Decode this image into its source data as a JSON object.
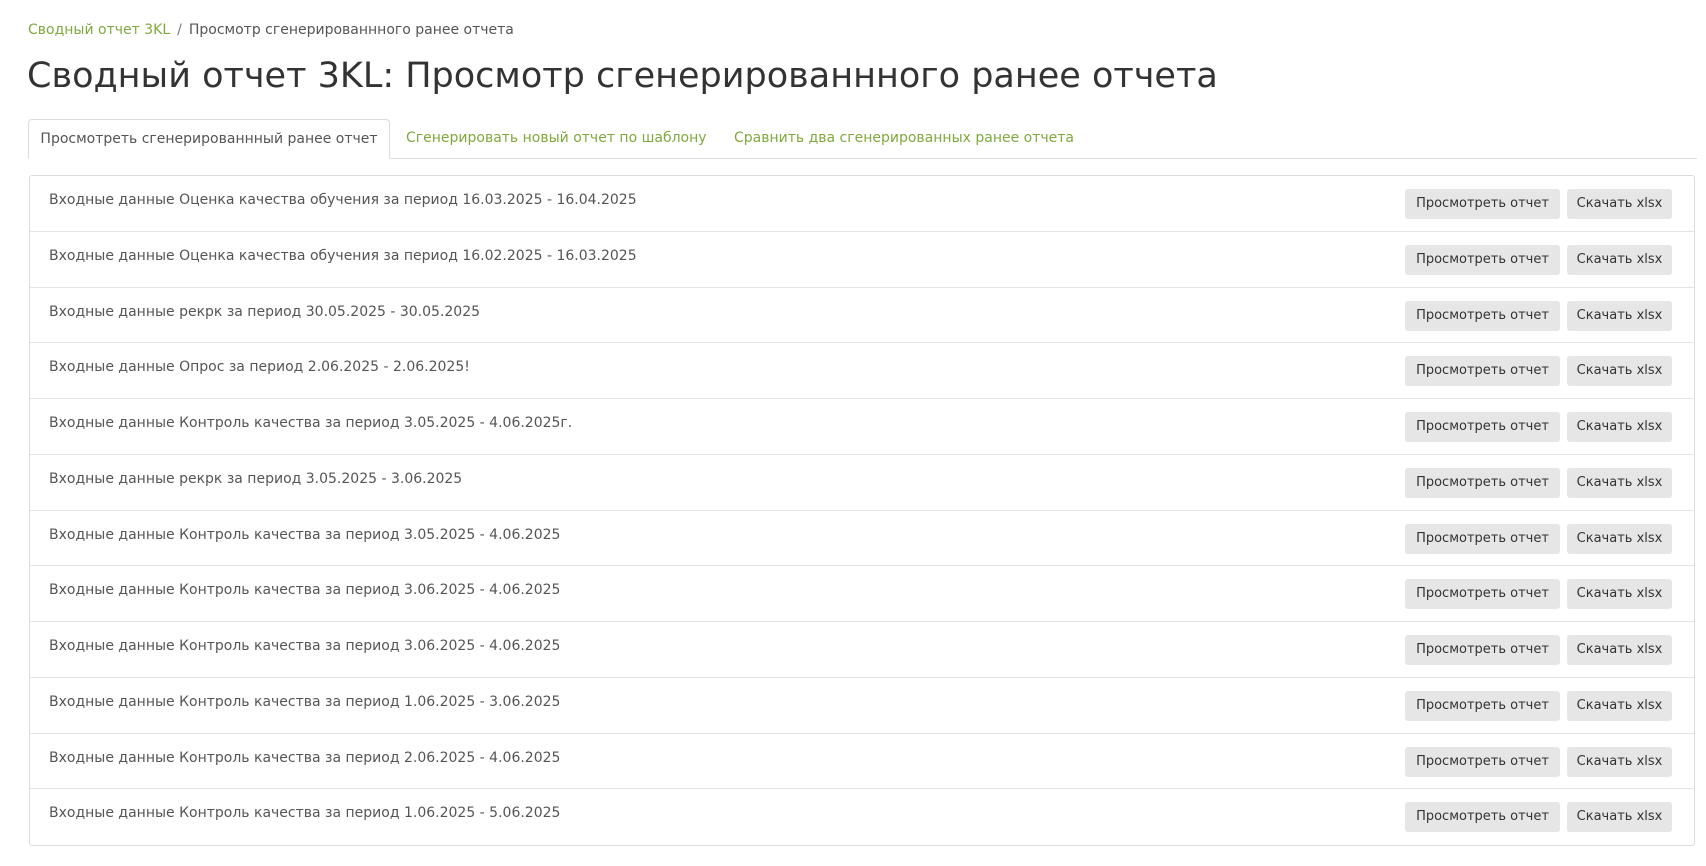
{
  "breadcrumb": {
    "root": "Сводный отчет 3KL",
    "separator": "/",
    "current": "Просмотр сгенерированнного ранее отчета"
  },
  "page_title": "Сводный отчет 3KL: Просмотр сгенерированнного ранее отчета",
  "tabs": [
    {
      "label": "Просмотреть сгенерированнный ранее отчет",
      "active": true
    },
    {
      "label": "Сгенерировать новый отчет по шаблону",
      "active": false
    },
    {
      "label": "Сравнить два сгенерированных ранее отчета",
      "active": false
    }
  ],
  "buttons": {
    "view": "Просмотреть отчет",
    "download": "Скачать xlsx"
  },
  "reports": [
    "Входные данные Оценка качества обучения за период 16.03.2025 - 16.04.2025",
    "Входные данные Оценка качества обучения за период 16.02.2025 - 16.03.2025",
    "Входные данные рекрк за период 30.05.2025 - 30.05.2025",
    "Входные данные Опрос за период 2.06.2025 - 2.06.2025!",
    "Входные данные Контроль качества за период 3.05.2025 - 4.06.2025г.",
    "Входные данные рекрк за период 3.05.2025 - 3.06.2025",
    "Входные данные Контроль качества за период 3.05.2025 - 4.06.2025",
    "Входные данные Контроль качества за период 3.06.2025 - 4.06.2025",
    "Входные данные Контроль качества за период 3.06.2025 - 4.06.2025",
    "Входные данные Контроль качества за период 1.06.2025 - 3.06.2025",
    "Входные данные Контроль качества за период 2.06.2025 - 4.06.2025",
    "Входные данные Контроль качества за период 1.06.2025 - 5.06.2025"
  ],
  "colors": {
    "accent": "#7fa93d",
    "button_bg": "#e6e6e6",
    "border": "#dcdcdc"
  }
}
